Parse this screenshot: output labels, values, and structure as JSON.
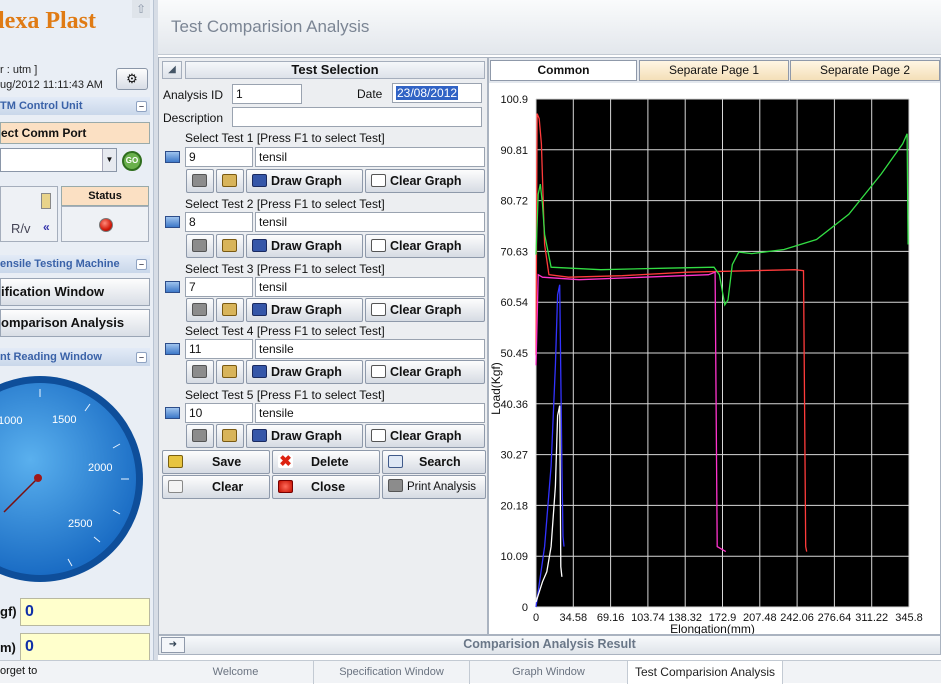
{
  "left": {
    "brand": "lexa Plast",
    "user_line": "r : utm ]",
    "datetime_line": "ug/2012  11:11:43 AM",
    "utm_header": "TM Control Unit",
    "comm_port_label": "ect Comm Port",
    "go_label": "GO",
    "rv_label": "R/v",
    "status_label": "Status",
    "machine_header": "ensile Testing Machine",
    "spec_button": "ification Window",
    "comp_button": "omparison Analysis",
    "reading_header": "nt Reading Window",
    "gauge_labels": [
      "1000",
      "1500",
      "2000",
      "2500"
    ],
    "load_label": "gf)",
    "load_value": "0",
    "ext_label": "m)",
    "ext_value": "0",
    "footer_text": "orget to"
  },
  "header": {
    "title": "Test Comparision Analysis"
  },
  "selection": {
    "title": "Test Selection",
    "analysis_id_label": "Analysis ID",
    "analysis_id": "1",
    "date_label": "Date",
    "date_value": "23/08/2012",
    "description_label": "Description",
    "description_value": "",
    "draw_label": "Draw Graph",
    "clear_graph_label": "Clear Graph",
    "tests": [
      {
        "prompt": "Select Test 1 [Press F1 to select Test]",
        "id": "9",
        "name": "tensil"
      },
      {
        "prompt": "Select Test 2 [Press F1 to select Test]",
        "id": "8",
        "name": "tensil"
      },
      {
        "prompt": "Select Test 3 [Press F1 to select Test]",
        "id": "7",
        "name": "tensil"
      },
      {
        "prompt": "Select Test 4 [Press F1 to select Test]",
        "id": "11",
        "name": "tensile"
      },
      {
        "prompt": "Select Test 5 [Press F1 to select Test]",
        "id": "10",
        "name": "tensile"
      }
    ],
    "save": "Save",
    "delete": "Delete",
    "search": "Search",
    "clear": "Clear",
    "close": "Close",
    "print": "Print Analysis"
  },
  "graph_tabs": [
    "Common",
    "Separate Page 1",
    "Separate Page 2"
  ],
  "chart_data": {
    "type": "line",
    "xlabel": "Elongation(mm)",
    "ylabel": "Load(Kgf)",
    "xlim": [
      0,
      345.8
    ],
    "ylim": [
      0,
      100.9
    ],
    "x_ticks": [
      "0",
      "34.58",
      "69.16",
      "103.74",
      "138.32",
      "172.9",
      "207.48",
      "242.06",
      "276.64",
      "311.22",
      "345.8"
    ],
    "y_ticks": [
      "0",
      "10.09",
      "20.18",
      "30.27",
      "40.36",
      "50.45",
      "60.54",
      "70.63",
      "80.72",
      "90.81",
      "100.9"
    ],
    "background": "#000000",
    "grid": true,
    "series": [
      {
        "color": "#ff3b3b",
        "points": [
          [
            0,
            50
          ],
          [
            1,
            98
          ],
          [
            3,
            97
          ],
          [
            5,
            92
          ],
          [
            8,
            72
          ],
          [
            12,
            66
          ],
          [
            30,
            65.5
          ],
          [
            80,
            65.8
          ],
          [
            140,
            66.5
          ],
          [
            200,
            66.8
          ],
          [
            240,
            67
          ],
          [
            248,
            66.8
          ],
          [
            250,
            12
          ],
          [
            251,
            11
          ]
        ]
      },
      {
        "color": "#33dd44",
        "points": [
          [
            0,
            70
          ],
          [
            2,
            82
          ],
          [
            4,
            84
          ],
          [
            6,
            80
          ],
          [
            8,
            74
          ],
          [
            14,
            67.5
          ],
          [
            60,
            67
          ],
          [
            120,
            67.3
          ],
          [
            165,
            67.5
          ],
          [
            170,
            66
          ],
          [
            175,
            60
          ],
          [
            178,
            61
          ],
          [
            182,
            68
          ],
          [
            188,
            70.5
          ],
          [
            200,
            70.2
          ],
          [
            230,
            71
          ],
          [
            260,
            73
          ],
          [
            290,
            78
          ],
          [
            320,
            86
          ],
          [
            340,
            92
          ],
          [
            344,
            94
          ],
          [
            345,
            72
          ]
        ]
      },
      {
        "color": "#ff33cc",
        "points": [
          [
            0,
            48
          ],
          [
            2,
            66
          ],
          [
            6,
            65.5
          ],
          [
            40,
            65
          ],
          [
            100,
            65.5
          ],
          [
            160,
            66
          ],
          [
            166,
            66.5
          ],
          [
            168,
            12
          ],
          [
            176,
            11
          ]
        ]
      },
      {
        "color": "#3333ff",
        "points": [
          [
            0,
            0
          ],
          [
            8,
            12
          ],
          [
            14,
            28
          ],
          [
            18,
            48
          ],
          [
            20,
            62
          ],
          [
            22,
            64
          ],
          [
            24,
            28
          ],
          [
            25,
            14
          ],
          [
            26,
            12
          ]
        ]
      },
      {
        "color": "#ffffff",
        "points": [
          [
            0,
            1
          ],
          [
            6,
            5
          ],
          [
            10,
            7
          ],
          [
            14,
            12
          ],
          [
            18,
            24
          ],
          [
            20,
            38
          ],
          [
            22,
            40
          ],
          [
            23,
            8
          ],
          [
            24,
            6
          ]
        ]
      }
    ]
  },
  "result_bar": {
    "title": "Comparision Analysis Result"
  },
  "bottom_tabs": [
    "Welcome",
    "Specification Window",
    "Graph Window",
    "Test Comparision Analysis"
  ],
  "colors": {
    "accent_orange": "#e07b14",
    "header_blue": "#3a62a8",
    "reading_blue": "#1030a8"
  }
}
